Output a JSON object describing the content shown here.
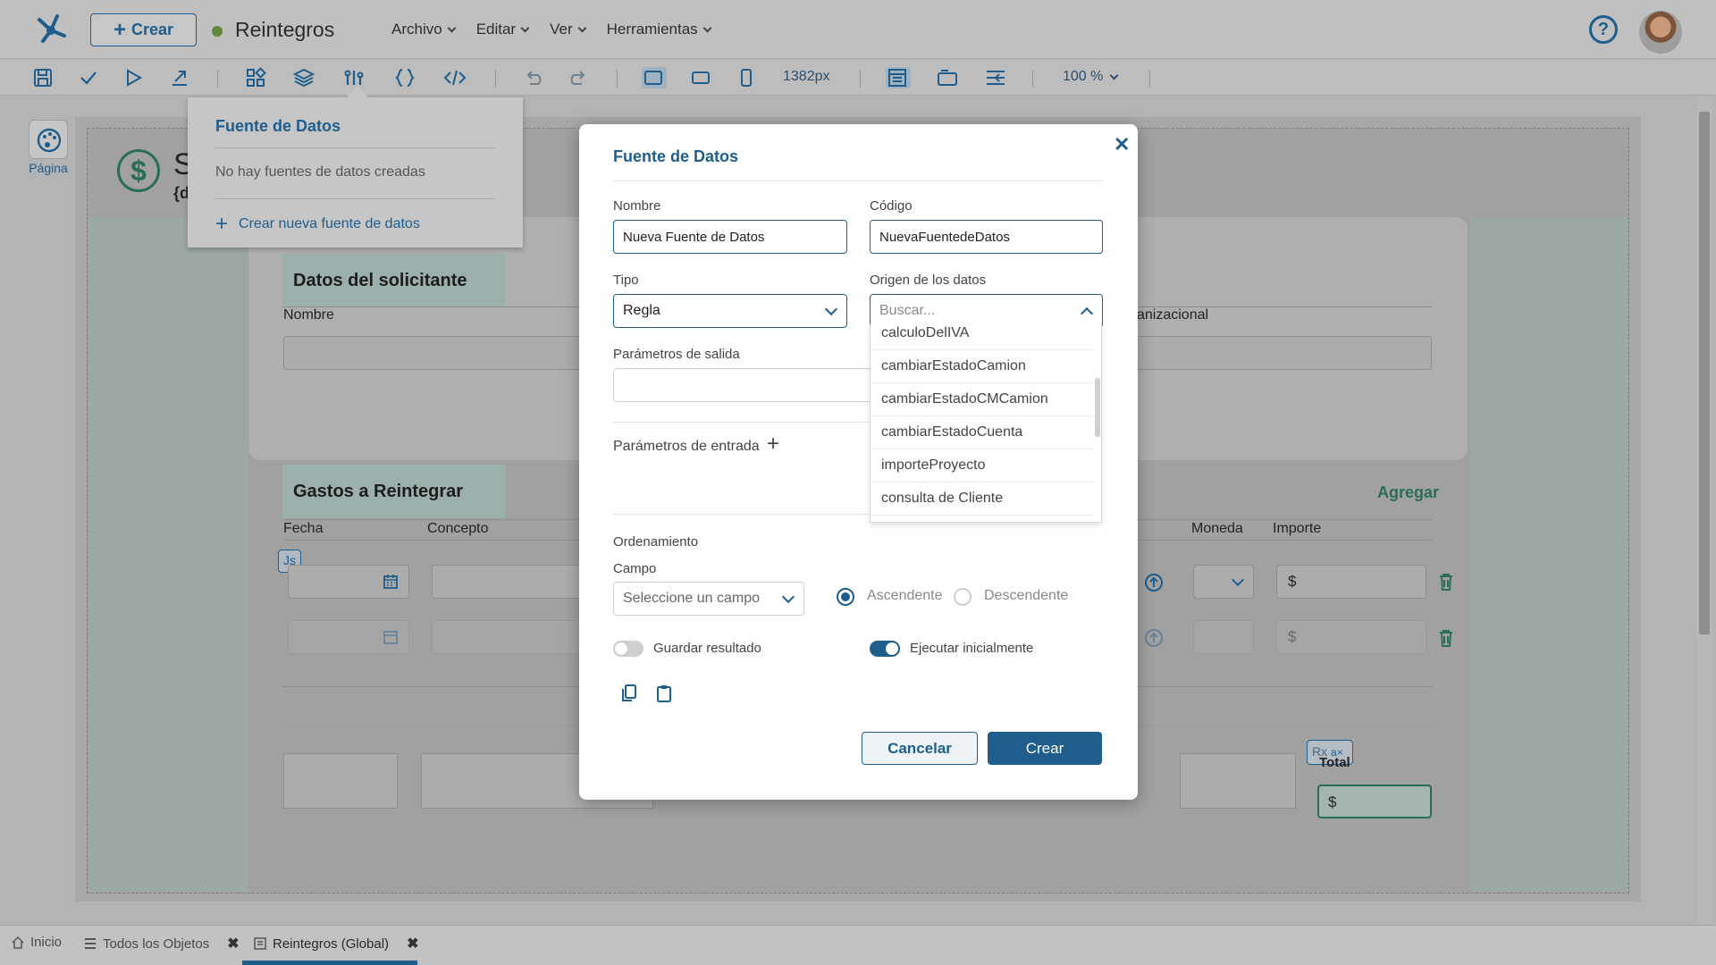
{
  "header": {
    "create_label": "Crear",
    "app_title": "Reintegros",
    "menu": [
      "Archivo",
      "Editar",
      "Ver",
      "Herramientas"
    ],
    "help_symbol": "?"
  },
  "toolbar": {
    "width_readout": "1382px",
    "zoom": "100 %"
  },
  "rail": {
    "page_label": "Página"
  },
  "canvas": {
    "page_title": "S",
    "page_subtitle": "{d",
    "section_applicant": "Datos del solicitante",
    "field_nombre": "Nombre",
    "field_org_partial": "anizacional",
    "section_expenses": "Gastos a Reintegrar",
    "add_label": "Agregar",
    "columns": {
      "fecha": "Fecha",
      "concepto": "Concepto",
      "moneda": "Moneda",
      "importe": "Importe"
    },
    "currency_symbol": "$",
    "js_badge": "Js",
    "rx_badge": "Rx",
    "total_label": "Total",
    "total_value": "$"
  },
  "popover": {
    "title": "Fuente de Datos",
    "empty_text": "No hay fuentes de datos creadas",
    "create_link": "Crear nueva fuente de datos"
  },
  "modal": {
    "title": "Fuente de Datos",
    "nombre_label": "Nombre",
    "nombre_value": "Nueva Fuente de Datos",
    "codigo_label": "Código",
    "codigo_value": "NuevaFuentedeDatos",
    "tipo_label": "Tipo",
    "tipo_value": "Regla",
    "origen_label": "Origen de los datos",
    "origen_placeholder": "Buscar...",
    "origen_options": [
      "calculoDelIVA",
      "cambiarEstadoCamion",
      "cambiarEstadoCMCamion",
      "cambiarEstadoCuenta",
      "importeProyecto",
      "consulta de Cliente"
    ],
    "salida_label": "Parámetros de salida",
    "entrada_label": "Parámetros de entrada",
    "orden_label": "Ordenamiento",
    "campo_label": "Campo",
    "campo_placeholder": "Seleccione un campo",
    "asc_label": "Ascendente",
    "desc_label": "Descendente",
    "sort_selected": "Ascendente",
    "guardar_label": "Guardar resultado",
    "guardar_on": false,
    "ejecutar_label": "Ejecutar inicialmente",
    "ejecutar_on": true,
    "cancel_label": "Cancelar",
    "create_label": "Crear"
  },
  "tabs": [
    {
      "label": "Inicio",
      "icon": "home-icon"
    },
    {
      "label": "Todos los Objetos",
      "icon": "list-icon"
    },
    {
      "label": "Reintegros (Global)",
      "icon": "form-icon",
      "active": true
    }
  ],
  "colors": {
    "accent": "#1f5d8c",
    "green": "#2a6f52",
    "status_dot": "#5e8a3a"
  }
}
